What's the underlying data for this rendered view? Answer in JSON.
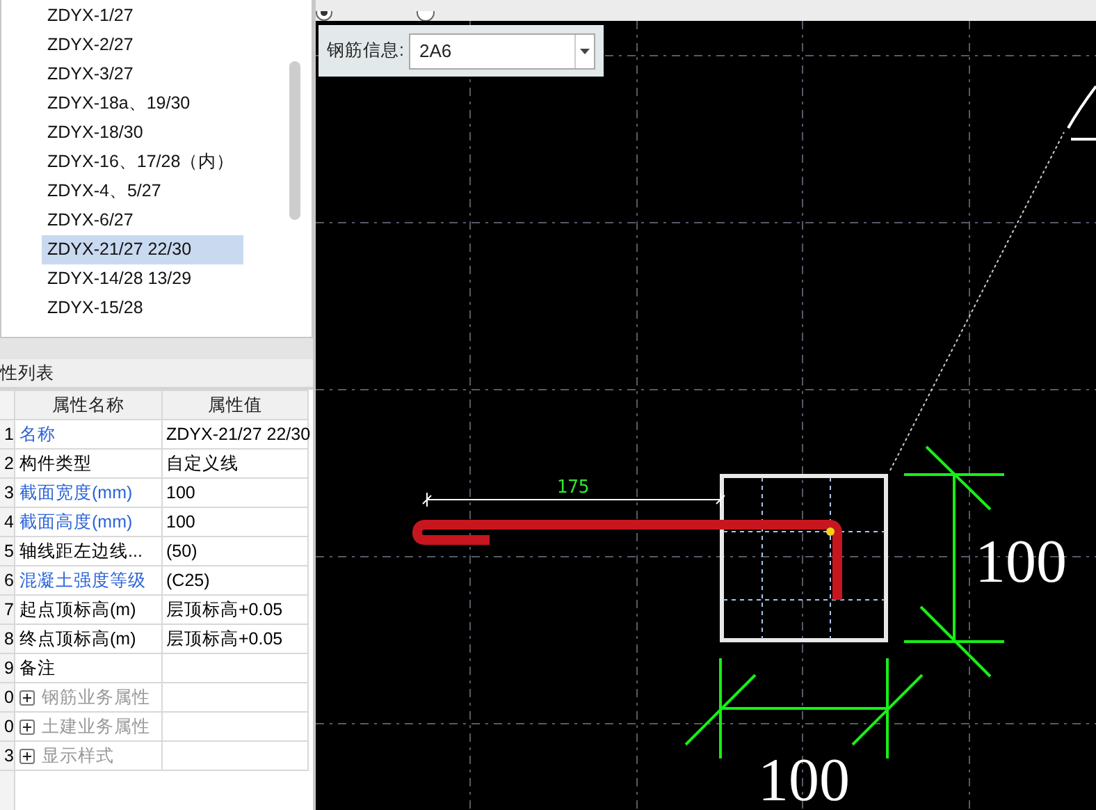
{
  "component_list": {
    "items": [
      {
        "label": "ZDYX-1/27",
        "selected": false
      },
      {
        "label": "ZDYX-2/27",
        "selected": false
      },
      {
        "label": "ZDYX-3/27",
        "selected": false
      },
      {
        "label": "ZDYX-18a、19/30",
        "selected": false
      },
      {
        "label": "ZDYX-18/30",
        "selected": false
      },
      {
        "label": "ZDYX-16、17/28（内）",
        "selected": false
      },
      {
        "label": "ZDYX-4、5/27",
        "selected": false
      },
      {
        "label": "ZDYX-6/27",
        "selected": false
      },
      {
        "label": "ZDYX-21/27 22/30",
        "selected": true
      },
      {
        "label": "ZDYX-14/28 13/29",
        "selected": false
      },
      {
        "label": "ZDYX-15/28",
        "selected": false
      }
    ]
  },
  "property_panel": {
    "title": "性列表",
    "columns": [
      "属性名称",
      "属性值"
    ],
    "rows": [
      {
        "number": "1",
        "kind": "field",
        "public": true,
        "name": "名称",
        "value": "ZDYX-21/27 22/30"
      },
      {
        "number": "2",
        "kind": "field",
        "public": false,
        "name": "构件类型",
        "value": "自定义线"
      },
      {
        "number": "3",
        "kind": "field",
        "public": true,
        "name": "截面宽度(mm)",
        "value": "100"
      },
      {
        "number": "4",
        "kind": "field",
        "public": true,
        "name": "截面高度(mm)",
        "value": "100"
      },
      {
        "number": "5",
        "kind": "field",
        "public": false,
        "name": "轴线距左边线...",
        "value": "(50)"
      },
      {
        "number": "6",
        "kind": "field",
        "public": true,
        "name": "混凝土强度等级",
        "value": "(C25)"
      },
      {
        "number": "7",
        "kind": "field",
        "public": false,
        "name": "起点顶标高(m)",
        "value": "层顶标高+0.05"
      },
      {
        "number": "8",
        "kind": "field",
        "public": false,
        "name": "终点顶标高(m)",
        "value": "层顶标高+0.05"
      },
      {
        "number": "9",
        "kind": "field",
        "public": false,
        "name": "备注"
      },
      {
        "number": "0",
        "kind": "group",
        "expanded": false,
        "name": "钢筋业务属性"
      },
      {
        "number": "0",
        "kind": "group",
        "expanded": false,
        "name": "土建业务属性"
      },
      {
        "number": "3",
        "kind": "group",
        "expanded": false,
        "name": "显示样式"
      }
    ]
  },
  "rebar_info": {
    "label": "钢筋信息:",
    "value": "2A6"
  },
  "drawing": {
    "length_dimension": "175",
    "height_dimension": "100",
    "width_dimension": "100"
  }
}
